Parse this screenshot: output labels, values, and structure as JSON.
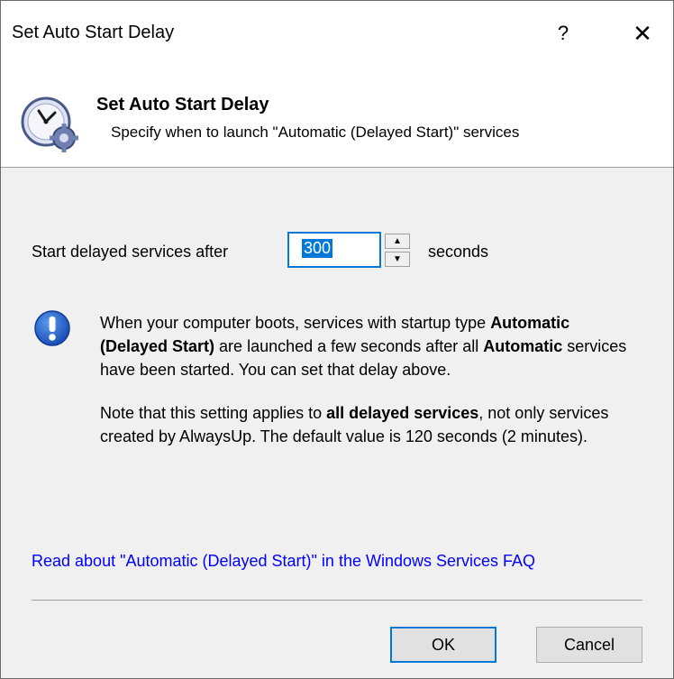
{
  "window": {
    "title": "Set Auto Start Delay",
    "help_glyph": "?",
    "close_glyph": "✕"
  },
  "header": {
    "title": "Set Auto Start Delay",
    "subtitle": "Specify when to launch \"Automatic (Delayed Start)\" services",
    "icon": "clock-gear-icon"
  },
  "delay": {
    "label_before": "Start delayed services after",
    "value": "300",
    "label_after": "seconds"
  },
  "info": {
    "icon": "exclamation-icon",
    "p1": [
      {
        "text": "When your computer boots, services with startup type ",
        "bold": false
      },
      {
        "text": "Automatic (Delayed Start)",
        "bold": true
      },
      {
        "text": " are launched a few seconds after all ",
        "bold": false
      },
      {
        "text": "Automatic",
        "bold": true
      },
      {
        "text": " services have been started. You can set that delay above.",
        "bold": false
      }
    ],
    "p2": [
      {
        "text": "Note that this setting applies to ",
        "bold": false
      },
      {
        "text": "all delayed services",
        "bold": true
      },
      {
        "text": ", not only services created by AlwaysUp. The default value is 120 seconds (2 minutes).",
        "bold": false
      }
    ]
  },
  "link": {
    "text": "Read about \"Automatic (Delayed Start)\" in the Windows Services FAQ"
  },
  "buttons": {
    "ok": "OK",
    "cancel": "Cancel"
  },
  "colors": {
    "accent": "#0078d7",
    "link": "#0000ff",
    "info_blue": "#1d5fc4"
  }
}
